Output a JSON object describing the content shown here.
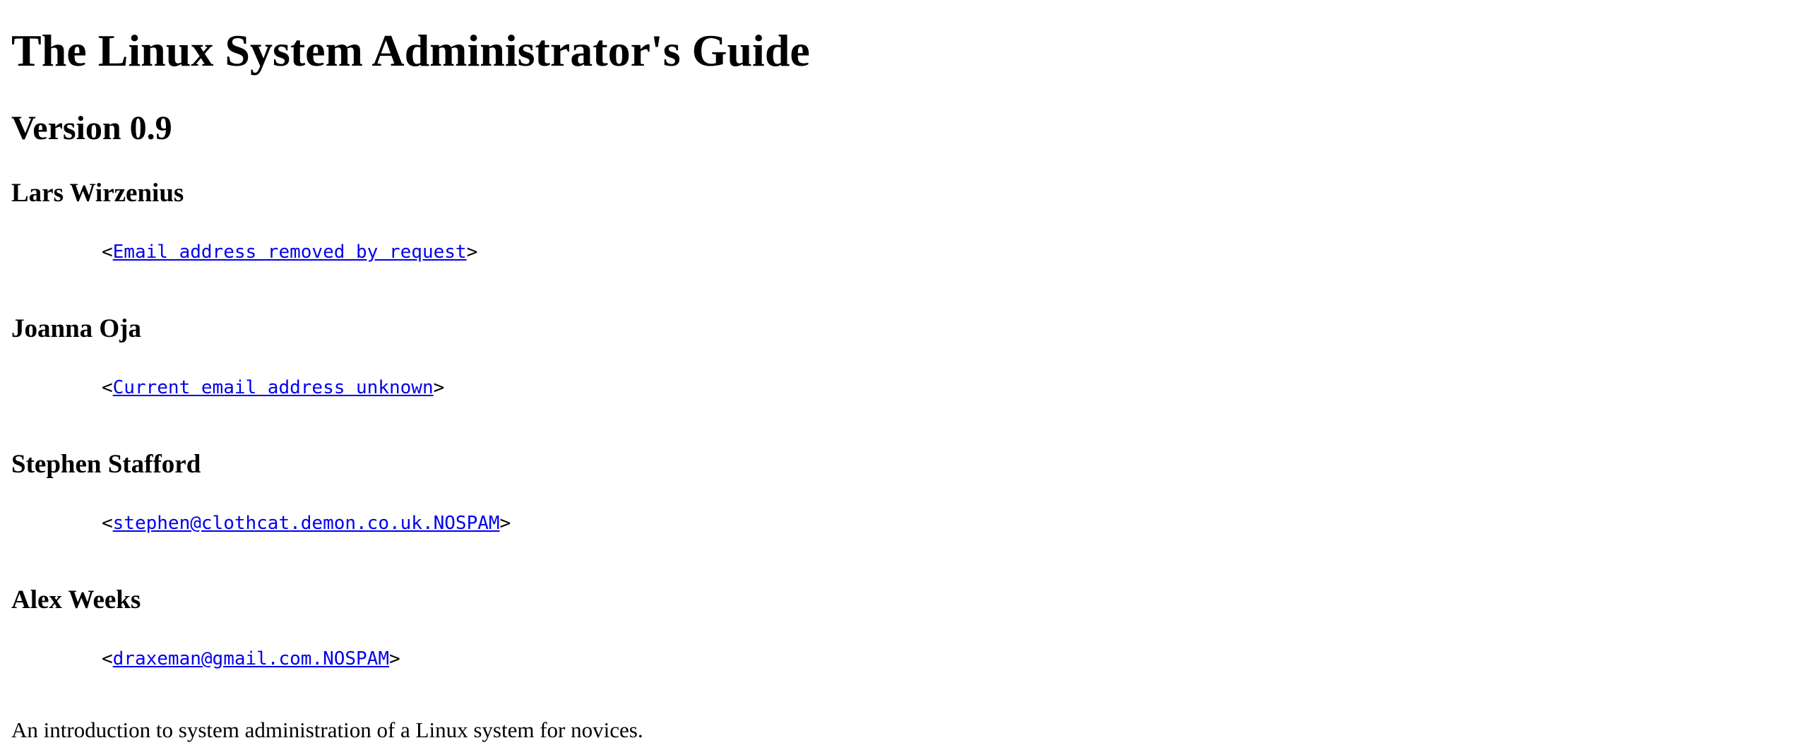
{
  "document": {
    "title": "The Linux System Administrator's Guide",
    "version": "Version 0.9",
    "authors": [
      {
        "name": "Lars Wirzenius",
        "email_link": "Email address removed by request"
      },
      {
        "name": "Joanna Oja",
        "email_link": "Current email address unknown"
      },
      {
        "name": "Stephen Stafford",
        "email_link": "stephen@clothcat.demon.co.uk.NOSPAM"
      },
      {
        "name": "Alex Weeks",
        "email_link": "draxeman@gmail.com.NOSPAM"
      }
    ],
    "email_open": "<",
    "email_close": ">",
    "abstract": "An introduction to system administration of a Linux system for novices."
  },
  "colors": {
    "link": "#0000ee",
    "text": "#000000",
    "background": "#ffffff"
  }
}
